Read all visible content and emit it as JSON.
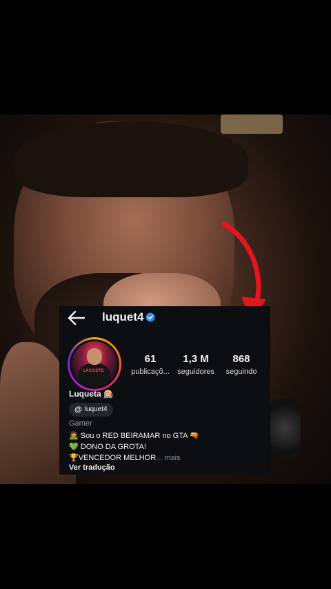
{
  "profile": {
    "username": "luquet4",
    "display_name": "Luqueta 🎰",
    "avatar_text": "LACOSTE",
    "threads_handle": "luquet4",
    "category": "Gamer",
    "bio_lines": [
      "🧟  Sou o RED BEIRAMAR no GTA 🔫",
      "💚 DONO DA GROTA!",
      "🏆VENCEDOR MELHOR"
    ],
    "bio_more": "... mais",
    "translate_label": "Ver tradução"
  },
  "stats": [
    {
      "value": "61",
      "label": "publicaçõ..."
    },
    {
      "value": "1,3 M",
      "label": "seguidores"
    },
    {
      "value": "868",
      "label": "seguindo"
    }
  ],
  "colors": {
    "card_bg": "#0d0e12",
    "verified": "#2d8cf0",
    "arrow": "#e3161d",
    "category": "#8e9ab5"
  }
}
